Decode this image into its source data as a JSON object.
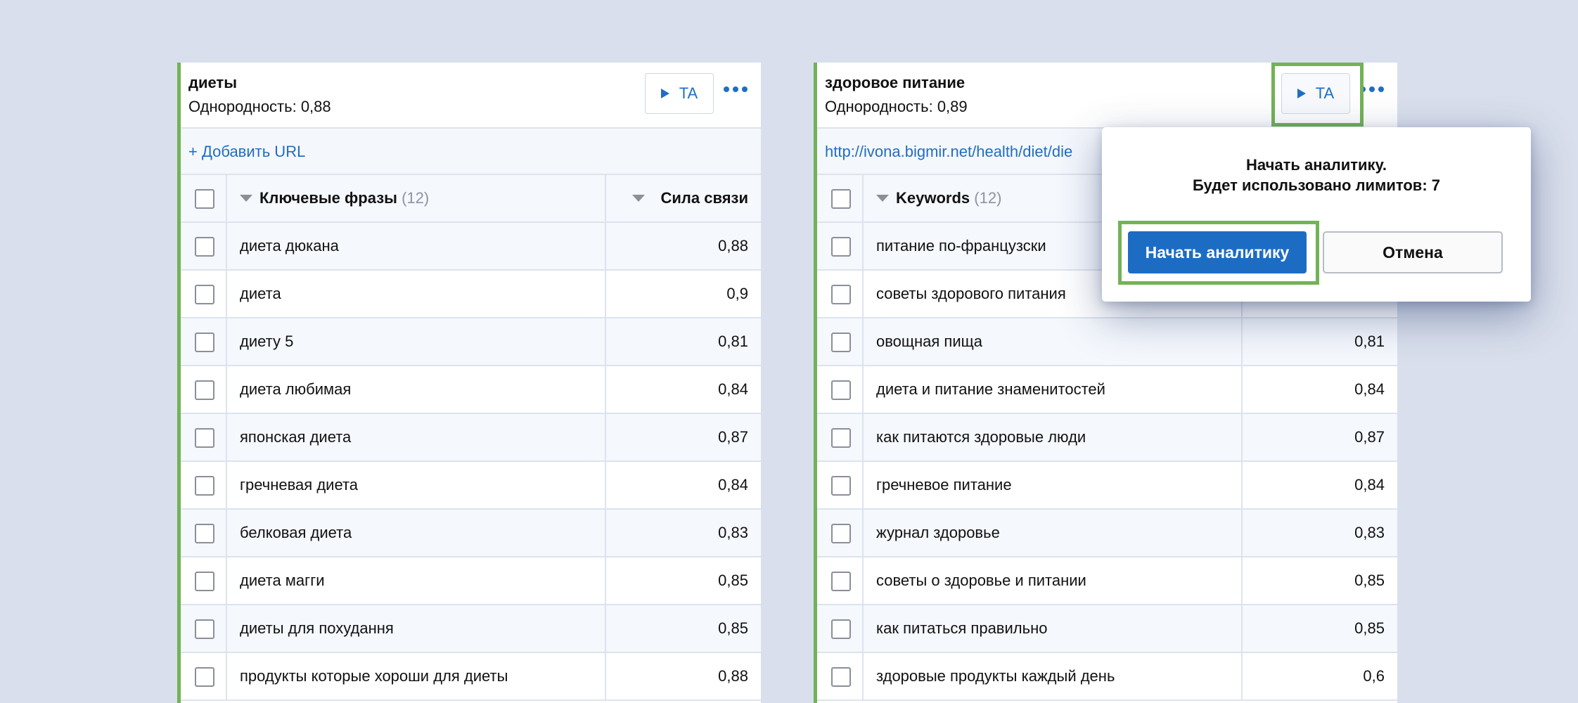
{
  "left_panel": {
    "title": "диеты",
    "homogeneity": "Однородность: 0,88",
    "ta_label": "TA",
    "add_url": "+ Добавить URL",
    "columns": {
      "keyword": "Ключевые фразы",
      "count": "(12)",
      "strength": "Сила связи"
    },
    "rows": [
      {
        "keyword": "диета дюкана",
        "value": "0,88"
      },
      {
        "keyword": "диета",
        "value": "0,9"
      },
      {
        "keyword": "диету 5",
        "value": "0,81"
      },
      {
        "keyword": "диета любимая",
        "value": "0,84"
      },
      {
        "keyword": "японская диета",
        "value": "0,87"
      },
      {
        "keyword": "гречневая диета",
        "value": "0,84"
      },
      {
        "keyword": "белковая диета",
        "value": "0,83"
      },
      {
        "keyword": "диета магги",
        "value": "0,85"
      },
      {
        "keyword": "диеты для похудання",
        "value": "0,85"
      },
      {
        "keyword": "продукты которые хороши для диеты",
        "value": "0,88"
      }
    ]
  },
  "right_panel": {
    "title": "здоровое питание",
    "homogeneity": "Однородность: 0,89",
    "ta_label": "TA",
    "url": "http://ivona.bigmir.net/health/diet/die",
    "columns": {
      "keyword": "Keywords",
      "count": "(12)"
    },
    "rows": [
      {
        "keyword": "питание по-французски",
        "value": ""
      },
      {
        "keyword": "советы здорового питания",
        "value": ""
      },
      {
        "keyword": "овощная пища",
        "value": "0,81"
      },
      {
        "keyword": "диета и питание знаменитостей",
        "value": "0,84"
      },
      {
        "keyword": "как питаются здоровые люди",
        "value": "0,87"
      },
      {
        "keyword": "гречневое питание",
        "value": "0,84"
      },
      {
        "keyword": "журнал здоровье",
        "value": "0,83"
      },
      {
        "keyword": "советы о здоровье и питании",
        "value": "0,85"
      },
      {
        "keyword": "как питаться правильно",
        "value": "0,85"
      },
      {
        "keyword": "здоровые продукты каждый день",
        "value": "0,6"
      }
    ]
  },
  "popup": {
    "line1": "Начать аналитику.",
    "line2": "Будет использовано лимитов: 7",
    "start_label": "Начать аналитику",
    "cancel_label": "Отмена"
  }
}
